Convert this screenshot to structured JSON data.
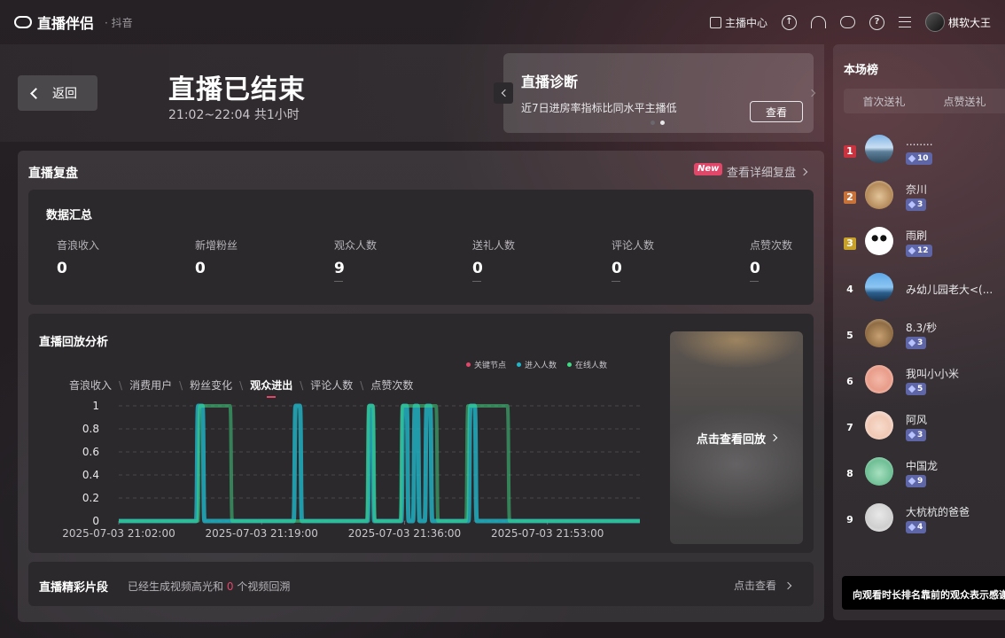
{
  "app": {
    "name": "直播伴侣",
    "platform": "· 抖音"
  },
  "topbar": {
    "studio_center": "主播中心",
    "username": "棋软大王"
  },
  "header": {
    "back_label": "返回",
    "title": "直播已结束",
    "time_range": "21:02~22:04 共1小时"
  },
  "diagnosis": {
    "title": "直播诊断",
    "desc": "近7日进房率指标比同水平主播低",
    "button": "查看",
    "pages": 2,
    "active_page": 2
  },
  "review": {
    "title": "直播复盘",
    "new_badge": "New",
    "detail_link": "查看详细复盘"
  },
  "summary": {
    "title": "数据汇总",
    "metrics": [
      {
        "label": "音浪收入",
        "value": "0"
      },
      {
        "label": "新增粉丝",
        "value": "0"
      },
      {
        "label": "观众人数",
        "value": "9"
      },
      {
        "label": "送礼人数",
        "value": "0"
      },
      {
        "label": "评论人数",
        "value": "0"
      },
      {
        "label": "点赞次数",
        "value": "0"
      }
    ]
  },
  "analysis": {
    "title": "直播回放分析",
    "tabs": [
      "音浪收入",
      "消费用户",
      "粉丝变化",
      "观众进出",
      "评论人数",
      "点赞次数"
    ],
    "active_tab": 3,
    "replay_label": "点击查看回放"
  },
  "chart_data": {
    "type": "area",
    "legend": [
      {
        "name": "关键节点",
        "color": "#e2476a"
      },
      {
        "name": "进入人数",
        "color": "#1fb6c9"
      },
      {
        "name": "在线人数",
        "color": "#3ddc84"
      }
    ],
    "ylim": [
      0,
      1
    ],
    "yticks": [
      "1",
      "0.8",
      "0.6",
      "0.4",
      "0.2",
      "0"
    ],
    "xticks": [
      "2025-07-03 21:02:00",
      "2025-07-03 21:19:00",
      "2025-07-03 21:36:00",
      "2025-07-03 21:53:00"
    ],
    "xticks_min": [
      0,
      17,
      34,
      51
    ],
    "x_max_min": 62,
    "series": [
      {
        "name": "进入人数",
        "color": "#1fb6c9",
        "pulses": [
          [
            9.2,
            10.2
          ],
          [
            20.8,
            21.8
          ],
          [
            29.6,
            30.4
          ],
          [
            33.6,
            34.5
          ],
          [
            35.0,
            35.8
          ],
          [
            36.4,
            37.3
          ],
          [
            41.6,
            42.6
          ]
        ]
      },
      {
        "name": "在线人数",
        "color": "#3ddc84",
        "pulses": [
          [
            9.4,
            13.5
          ],
          [
            29.5,
            30.5
          ],
          [
            33.5,
            38.0
          ],
          [
            41.3,
            46.5
          ]
        ]
      }
    ]
  },
  "clips": {
    "title": "直播精彩片段",
    "desc_prefix": "已经生成视频高光和",
    "count": "0",
    "desc_suffix": "个视频回溯",
    "link": "点击查看"
  },
  "ranking": {
    "title": "本场榜",
    "tabs": [
      "首次送礼",
      "点赞送礼"
    ],
    "items": [
      {
        "rank": "1",
        "name": "........",
        "level": "10",
        "rank_color": "#c8333f",
        "avatar": "mountain-avatar"
      },
      {
        "rank": "2",
        "name": "奈川",
        "level": "3",
        "rank_color": "#c8723a",
        "avatar": "cat-avatar"
      },
      {
        "rank": "3",
        "name": "雨刷",
        "level": "12",
        "rank_color": "#c8a12a",
        "avatar": "panda-avatar"
      },
      {
        "rank": "4",
        "name": "み幼儿园老大<(...",
        "level": "",
        "rank_color": "",
        "avatar": "pavilion-avatar"
      },
      {
        "rank": "5",
        "name": "8.3/秒",
        "level": "3",
        "rank_color": "",
        "avatar": "shell-avatar"
      },
      {
        "rank": "6",
        "name": "我叫小小米",
        "level": "5",
        "rank_color": "",
        "avatar": "hands-avatar"
      },
      {
        "rank": "7",
        "name": "阿风",
        "level": "3",
        "rank_color": "",
        "avatar": "kid-avatar"
      },
      {
        "rank": "8",
        "name": "中国龙",
        "level": "9",
        "rank_color": "",
        "avatar": "frog-avatar"
      },
      {
        "rank": "9",
        "name": "大杭杭的爸爸",
        "level": "4",
        "rank_color": "",
        "avatar": "person-avatar"
      }
    ],
    "tooltip": "向观看时长排名靠前的观众表示感谢"
  }
}
